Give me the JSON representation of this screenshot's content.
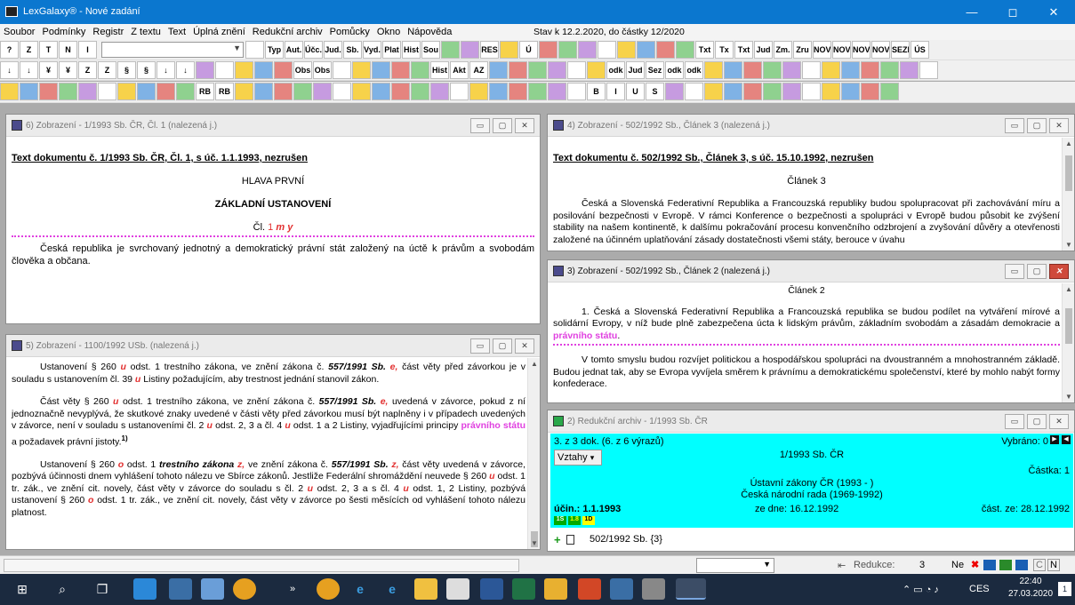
{
  "window": {
    "title": "LexGalaxy® - Nové zadání",
    "min": "—",
    "max": "◻",
    "close": "✕"
  },
  "menu": {
    "items": [
      "Soubor",
      "Podmínky",
      "Registr",
      "Z textu",
      "Text",
      "Úplná znění",
      "Redukční archiv",
      "Pomůcky",
      "Okno",
      "Nápověda"
    ],
    "stav": "Stav k 12.2.2020, do částky 12/2020"
  },
  "toolbar1": [
    "?",
    "Z",
    "T",
    "N",
    "I",
    "",
    "Typ",
    "Aut.",
    "Účc.",
    "Jud.",
    "Sb.",
    "Vyd.",
    "Plat",
    "Hist",
    "Sou",
    "",
    "",
    "RES",
    "",
    "Ú",
    "",
    "",
    "",
    "",
    "",
    "",
    "",
    "",
    "Txt",
    "Tx",
    "Txt",
    "Jud",
    "Zm.",
    "Zru",
    "NOVÉ",
    "NOVÉ",
    "NOVÉ",
    "NOVÉ",
    "SEZN",
    "ÚS"
  ],
  "toolbar2": [
    "↓",
    "↓",
    "¥",
    "¥",
    "Z",
    "Z",
    "§",
    "§",
    "↓",
    "↓",
    "",
    "",
    "",
    "",
    "",
    "Obs",
    "Obs",
    "",
    "",
    "",
    "",
    "",
    "Hist",
    "Akt",
    "AZ",
    "",
    "",
    "",
    "",
    "",
    "",
    "odk",
    "Jud",
    "Sez",
    "odk",
    "odk",
    "",
    "",
    "",
    "",
    "",
    "",
    "",
    "",
    "",
    "",
    "",
    ""
  ],
  "toolbar3": [
    "",
    "",
    "",
    "",
    "",
    "",
    "",
    "",
    "",
    "",
    "RB",
    "RB",
    "",
    "",
    "",
    "",
    "",
    "",
    "",
    "",
    "",
    "",
    "",
    "",
    "",
    "",
    "",
    "",
    "",
    "",
    "B",
    "I",
    "U",
    "S",
    "",
    "",
    "",
    "",
    "",
    "",
    "",
    "",
    "",
    "",
    "",
    ""
  ],
  "windows": {
    "w6": {
      "title": "6) Zobrazení - 1/1993 Sb. ČR, Čl. 1 (nalezená j.)",
      "heading": "Text dokumentu č. 1/1993 Sb. ČR, Čl. 1, s úč. 1.1.1993, nezrušen",
      "hlava": "HLAVA PRVNÍ",
      "zakl": "ZÁKLADNÍ USTANOVENÍ",
      "cl_prefix": "Čl.",
      "cl_num": "1",
      "cl_mark": "m y",
      "para": "Česká republika je svrchovaný jednotný a demokratický právní stát založený na úctě k právům a svobodám člověka a občana."
    },
    "w5": {
      "title": "5) Zobrazení - 1100/1992 USb. (nalezená j.)",
      "p1a": "Ustanovení § 260",
      "p1u": "u",
      "p1b": "odst. 1 trestního zákona, ve znění zákona č.",
      "p1c": "557/1991 Sb.",
      "p1e": "e,",
      "p1d": "část věty před závorkou je v souladu s ustanovením čl. 39",
      "p1u2": "u",
      "p1f": "Listiny požadujícím, aby trestnost jednání stanovil zákon.",
      "p2a": "Část věty § 260",
      "p2u": "u",
      "p2b": "odst. 1 trestního zákona, ve znění zákona č.",
      "p2c": "557/1991 Sb.",
      "p2e": "e,",
      "p2d": "uvedená v závorce, pokud z ní jednoznačně nevyplývá, že skutkové znaky uvedené v části věty před závorkou musí být naplněny i v případech uvedených v závorce, není v souladu s ustanoveními čl. 2",
      "p2u2": "u",
      "p2f": "odst. 2, 3 a čl. 4",
      "p2u3": "u",
      "p2g": "odst. 1 a 2 Listiny, vyjadřujícími principy",
      "p2m": "právního státu",
      "p2h": "a požadavek právní jistoty.",
      "p2sup": "1)",
      "p3a": "Ustanovení § 260",
      "p3o": "o",
      "p3b": "odst. 1",
      "p3c": "trestního zákona",
      "p3z": "z,",
      "p3d": "ve znění zákona č.",
      "p3e": "557/1991 Sb.",
      "p3z2": "z,",
      "p3f": "část věty uvedená v závorce, pozbývá účinnosti dnem vyhlášení tohoto nálezu ve Sbírce zákonů. Jestliže Federální shromáždění neuvede § 260",
      "p3u": "u",
      "p3g": "odst. 1 tr. zák., ve znění cit. novely, část věty v závorce do souladu s čl. 2",
      "p3u2": "u",
      "p3h": "odst. 2, 3 a s čl. 4",
      "p3u3": "u",
      "p3i": "odst. 1, 2 Listiny, pozbývá ustanovení § 260",
      "p3o2": "o",
      "p3j": "odst. 1 tr. zák., ve znění cit. novely, část věty v závorce po šesti měsících od vyhlášení tohoto nálezu platnost."
    },
    "w4": {
      "title": "4) Zobrazení - 502/1992 Sb., Článek 3 (nalezená j.)",
      "heading": "Text dokumentu č. 502/1992 Sb., Článek 3, s úč. 15.10.1992, nezrušen",
      "clanek": "Článek 3",
      "para": "Česká a Slovenská Federativní Republika a Francouzská republiky budou spolupracovat při zachovávání míru a posilování bezpečnosti v Evropě. V rámci Konference o bezpečnosti a spolupráci v Evropě budou působit ke zvýšení stability na našem kontinentě, k dalšímu pokračování procesu konvenčního odzbrojení a zvyšování důvěry a otevřenosti založené na účinném uplatňování zásady dostatečnosti všemi státy, berouce v úvahu"
    },
    "w3": {
      "title": "3) Zobrazení - 502/1992 Sb., Článek 2 (nalezená j.)",
      "clanek": "Článek 2",
      "p1": "1. Česká a Slovenská Federativní Republika a Francouzská republika se budou podílet na vytváření mírové a solidární Evropy, v níž bude plně zabezpečena úcta k lidským právům, základním svobodám a zásadám demokracie a",
      "p1m": "právního státu",
      "p1end": ".",
      "p2": "V tomto smyslu budou rozvíjet politickou a hospodářskou spolupráci na dvoustranném a mnohostranném základě. Budou jednat tak, aby se Evropa vyvíjela směrem k právnímu a demokratickému společenství, které by mohlo nabýt formy konfederace."
    },
    "w2": {
      "title": "2) Redukční archiv - 1/1993 Sb. ČR",
      "dok": "3. z 3 dok. (6. z 6 výrazů)",
      "vybrano": "Vybráno: 0",
      "vztahy": "Vztahy",
      "docnum": "1/1993 Sb. ČR",
      "castka": "Částka: 1",
      "title1": "Ústavní zákony ČR (1993 -   )",
      "title2": "Česká národní rada (1969-1992)",
      "ucin": "účin.: 1.1.1993",
      "zedne": "ze dne: 16.12.1992",
      "cast": "část. ze: 28.12.1992",
      "badges": [
        "1S",
        "1.8",
        "1D"
      ],
      "link": "502/1992 Sb. {3}"
    }
  },
  "status": {
    "redukce_label": "Redukce:",
    "redukce_val": "3",
    "ne": "Ne",
    "c": "C",
    "n": "N"
  },
  "taskbar": {
    "lang": "CES",
    "time": "22:40",
    "date": "27.03.2020",
    "notif": "1"
  }
}
